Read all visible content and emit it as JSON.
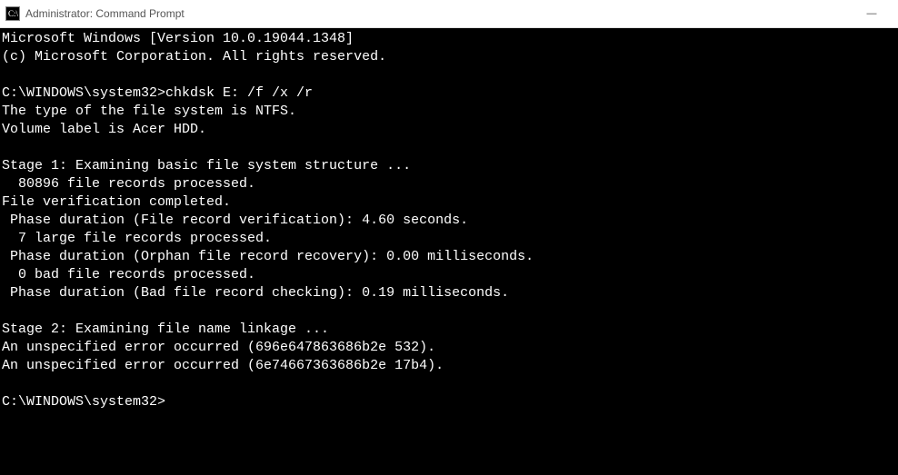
{
  "window": {
    "title": "Administrator: Command Prompt",
    "icon_name": "cmd-icon"
  },
  "terminal": {
    "lines": [
      "Microsoft Windows [Version 10.0.19044.1348]",
      "(c) Microsoft Corporation. All rights reserved.",
      "",
      "C:\\WINDOWS\\system32>chkdsk E: /f /x /r",
      "The type of the file system is NTFS.",
      "Volume label is Acer HDD.",
      "",
      "Stage 1: Examining basic file system structure ...",
      "  80896 file records processed.",
      "File verification completed.",
      " Phase duration (File record verification): 4.60 seconds.",
      "  7 large file records processed.",
      " Phase duration (Orphan file record recovery): 0.00 milliseconds.",
      "  0 bad file records processed.",
      " Phase duration (Bad file record checking): 0.19 milliseconds.",
      "",
      "Stage 2: Examining file name linkage ...",
      "An unspecified error occurred (696e647863686b2e 532).",
      "An unspecified error occurred (6e74667363686b2e 17b4).",
      "",
      "C:\\WINDOWS\\system32>"
    ]
  },
  "controls": {
    "minimize": "—"
  }
}
